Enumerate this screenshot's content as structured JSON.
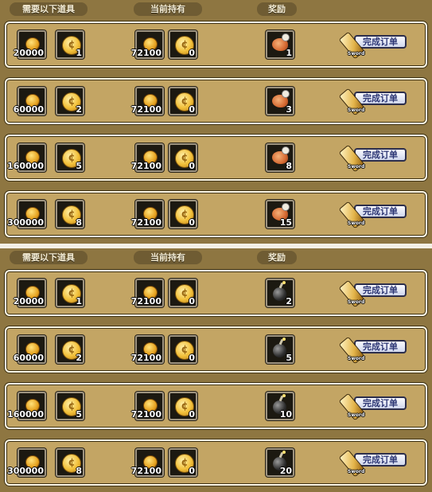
{
  "headers": {
    "required": "需要以下道具",
    "current": "当前持有",
    "reward": "奖励"
  },
  "button_label": "完成订单",
  "button_tag": "Sword",
  "colors": {
    "panel": "#8e7641",
    "row": "#c3a564",
    "slot": "#1c1911",
    "button_text": "#2b3573"
  },
  "panels": [
    {
      "rows": [
        {
          "req_coin": "20000",
          "req_medal": "1",
          "have_coin": "72100",
          "have_medal": "0",
          "reward_icon": "roast-meat-icon",
          "reward_qty": "1"
        },
        {
          "req_coin": "60000",
          "req_medal": "2",
          "have_coin": "72100",
          "have_medal": "0",
          "reward_icon": "roast-meat-icon",
          "reward_qty": "3"
        },
        {
          "req_coin": "160000",
          "req_medal": "5",
          "have_coin": "72100",
          "have_medal": "0",
          "reward_icon": "roast-meat-icon",
          "reward_qty": "8"
        },
        {
          "req_coin": "300000",
          "req_medal": "8",
          "have_coin": "72100",
          "have_medal": "0",
          "reward_icon": "roast-meat-icon",
          "reward_qty": "15"
        }
      ]
    },
    {
      "rows": [
        {
          "req_coin": "20000",
          "req_medal": "1",
          "have_coin": "72100",
          "have_medal": "0",
          "reward_icon": "bomb-icon",
          "reward_qty": "2"
        },
        {
          "req_coin": "60000",
          "req_medal": "2",
          "have_coin": "72100",
          "have_medal": "0",
          "reward_icon": "bomb-icon",
          "reward_qty": "5"
        },
        {
          "req_coin": "160000",
          "req_medal": "5",
          "have_coin": "72100",
          "have_medal": "0",
          "reward_icon": "bomb-icon",
          "reward_qty": "10"
        },
        {
          "req_coin": "300000",
          "req_medal": "8",
          "have_coin": "72100",
          "have_medal": "0",
          "reward_icon": "bomb-icon",
          "reward_qty": "20"
        }
      ]
    }
  ]
}
